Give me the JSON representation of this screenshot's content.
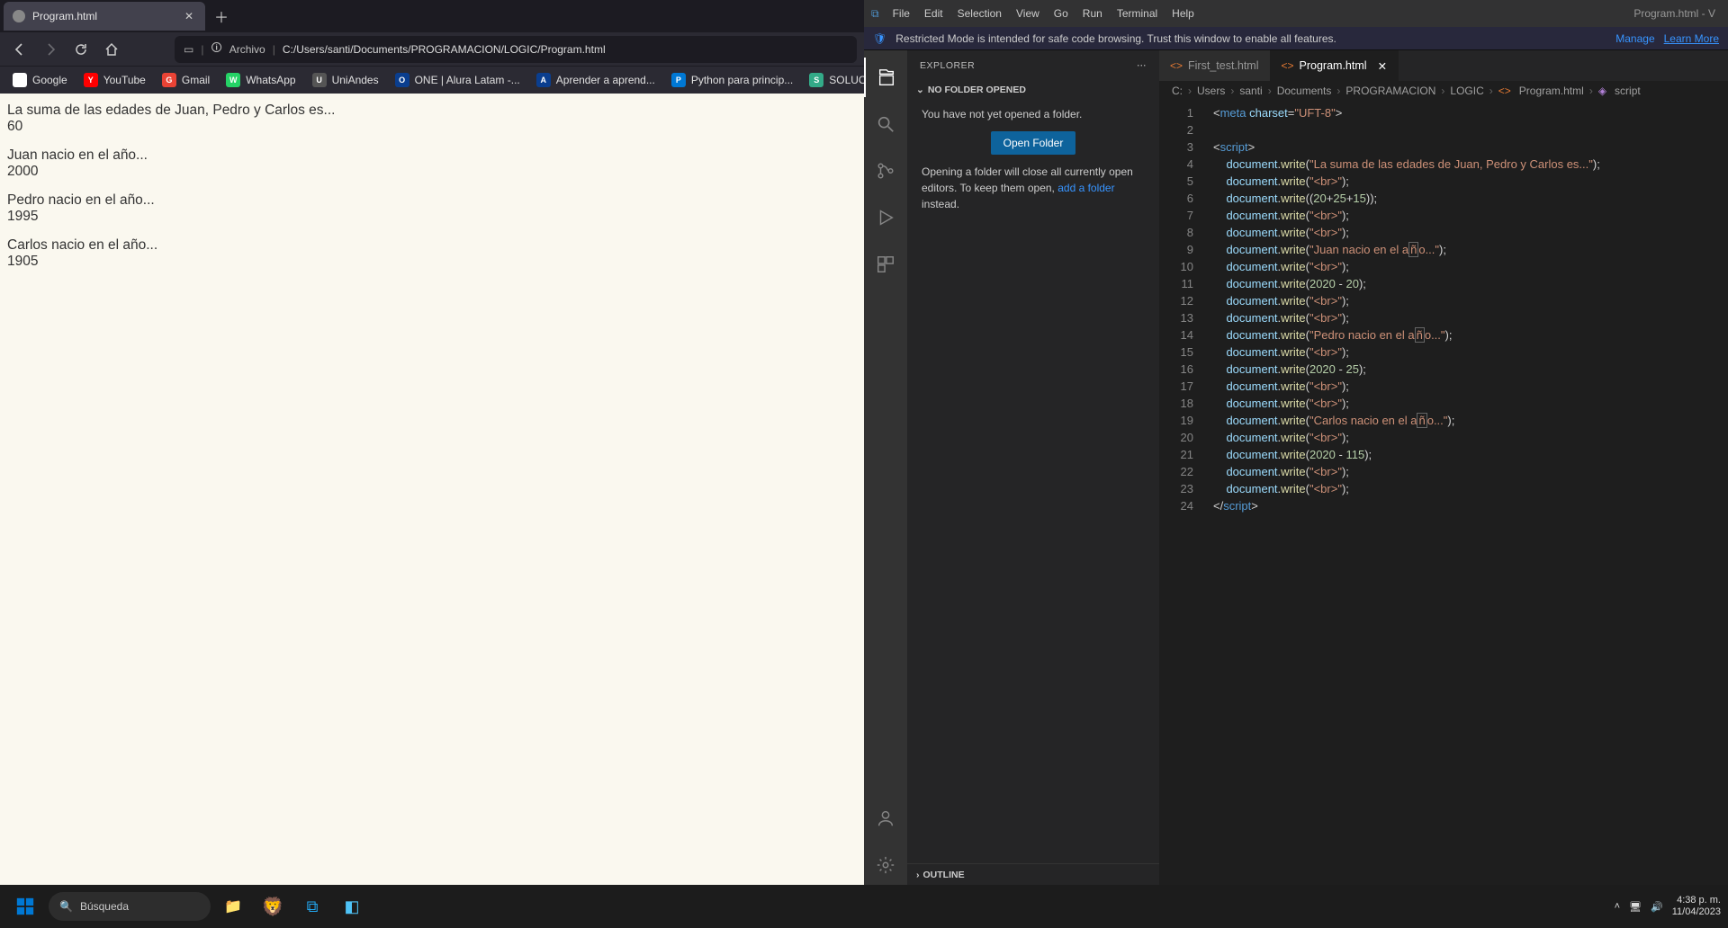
{
  "browser": {
    "tab_title": "Program.html",
    "address_label": "Archivo",
    "address_path": "C:/Users/santi/Documents/PROGRAMACION/LOGIC/Program.html",
    "bookmarks": [
      {
        "label": "Google",
        "color": "#fff"
      },
      {
        "label": "YouTube",
        "color": "#f00"
      },
      {
        "label": "Gmail",
        "color": "#ea4335"
      },
      {
        "label": "WhatsApp",
        "color": "#25d366"
      },
      {
        "label": "UniAndes",
        "color": "#555"
      },
      {
        "label": "ONE | Alura Latam -...",
        "color": "#0a3e8f"
      },
      {
        "label": "Aprender a aprend...",
        "color": "#0a3e8f"
      },
      {
        "label": "Python para princip...",
        "color": "#0078d4"
      },
      {
        "label": "SOLUCI...",
        "color": "#3a8"
      }
    ],
    "page": {
      "line1": "La suma de las edades de Juan, Pedro y Carlos es...",
      "line1_val": "60",
      "line2": "Juan nacio en el año...",
      "line2_val": "2000",
      "line3": "Pedro nacio en el año...",
      "line3_val": "1995",
      "line4": "Carlos nacio en el año...",
      "line4_val": "1905"
    }
  },
  "vscode": {
    "window_title": "Program.html - V",
    "menus": [
      "File",
      "Edit",
      "Selection",
      "View",
      "Go",
      "Run",
      "Terminal",
      "Help"
    ],
    "notification": "Restricted Mode is intended for safe code browsing. Trust this window to enable all features.",
    "notif_manage": "Manage",
    "notif_learn": "Learn More",
    "sidebar": {
      "title": "EXPLORER",
      "section": "NO FOLDER OPENED",
      "msg1": "You have not yet opened a folder.",
      "open_btn": "Open Folder",
      "msg2a": "Opening a folder will close all currently open editors. To keep them open, ",
      "msg2b": "add a folder",
      "msg2c": " instead.",
      "outline": "OUTLINE"
    },
    "tabs": [
      {
        "label": "First_test.html",
        "active": false
      },
      {
        "label": "Program.html",
        "active": true
      }
    ],
    "breadcrumbs": [
      "C:",
      "Users",
      "santi",
      "Documents",
      "PROGRAMACION",
      "LOGIC",
      "Program.html",
      "script"
    ],
    "code_lines": [
      {
        "n": 1,
        "html": "<span class='tk-pun'>&lt;</span><span class='tk-tag'>meta</span> <span class='tk-attr'>charset</span><span class='tk-pun'>=</span><span class='tk-str'>\"UFT-8\"</span><span class='tk-pun'>&gt;</span>"
      },
      {
        "n": 2,
        "html": ""
      },
      {
        "n": 3,
        "html": "<span class='tk-pun'>&lt;</span><span class='tk-tag'>script</span><span class='tk-pun'>&gt;</span>"
      },
      {
        "n": 4,
        "html": "    <span class='tk-obj'>document</span><span class='tk-pun'>.</span><span class='tk-fn'>write</span><span class='tk-pun'>(</span><span class='tk-str'>\"La suma de las edades de Juan, Pedro y Carlos es...\"</span><span class='tk-pun'>);</span>"
      },
      {
        "n": 5,
        "html": "    <span class='tk-obj'>document</span><span class='tk-pun'>.</span><span class='tk-fn'>write</span><span class='tk-pun'>(</span><span class='tk-str'>\"&lt;br&gt;\"</span><span class='tk-pun'>);</span>"
      },
      {
        "n": 6,
        "html": "    <span class='tk-obj'>document</span><span class='tk-pun'>.</span><span class='tk-fn'>write</span><span class='tk-pun'>((</span><span class='tk-num'>20</span><span class='tk-pun'>+</span><span class='tk-num'>25</span><span class='tk-pun'>+</span><span class='tk-num'>15</span><span class='tk-pun'>));</span>"
      },
      {
        "n": 7,
        "html": "    <span class='tk-obj'>document</span><span class='tk-pun'>.</span><span class='tk-fn'>write</span><span class='tk-pun'>(</span><span class='tk-str'>\"&lt;br&gt;\"</span><span class='tk-pun'>);</span>"
      },
      {
        "n": 8,
        "html": "    <span class='tk-obj'>document</span><span class='tk-pun'>.</span><span class='tk-fn'>write</span><span class='tk-pun'>(</span><span class='tk-str'>\"&lt;br&gt;\"</span><span class='tk-pun'>);</span>"
      },
      {
        "n": 9,
        "html": "    <span class='tk-obj'>document</span><span class='tk-pun'>.</span><span class='tk-fn'>write</span><span class='tk-pun'>(</span><span class='tk-str'>\"Juan nacio en el a<span class='hl-box'>ñ</span>o...\"</span><span class='tk-pun'>);</span>"
      },
      {
        "n": 10,
        "html": "    <span class='tk-obj'>document</span><span class='tk-pun'>.</span><span class='tk-fn'>write</span><span class='tk-pun'>(</span><span class='tk-str'>\"&lt;br&gt;\"</span><span class='tk-pun'>);</span>"
      },
      {
        "n": 11,
        "html": "    <span class='tk-obj'>document</span><span class='tk-pun'>.</span><span class='tk-fn'>write</span><span class='tk-pun'>(</span><span class='tk-num'>2020</span> <span class='tk-pun'>-</span> <span class='tk-num'>20</span><span class='tk-pun'>);</span>"
      },
      {
        "n": 12,
        "html": "    <span class='tk-obj'>document</span><span class='tk-pun'>.</span><span class='tk-fn'>write</span><span class='tk-pun'>(</span><span class='tk-str'>\"&lt;br&gt;\"</span><span class='tk-pun'>);</span>"
      },
      {
        "n": 13,
        "html": "    <span class='tk-obj'>document</span><span class='tk-pun'>.</span><span class='tk-fn'>write</span><span class='tk-pun'>(</span><span class='tk-str'>\"&lt;br&gt;\"</span><span class='tk-pun'>);</span>"
      },
      {
        "n": 14,
        "html": "    <span class='tk-obj'>document</span><span class='tk-pun'>.</span><span class='tk-fn'>write</span><span class='tk-pun'>(</span><span class='tk-str'>\"Pedro nacio en el a<span class='hl-box'>ñ</span>o...\"</span><span class='tk-pun'>);</span>"
      },
      {
        "n": 15,
        "html": "    <span class='tk-obj'>document</span><span class='tk-pun'>.</span><span class='tk-fn'>write</span><span class='tk-pun'>(</span><span class='tk-str'>\"&lt;br&gt;\"</span><span class='tk-pun'>);</span>"
      },
      {
        "n": 16,
        "html": "    <span class='tk-obj'>document</span><span class='tk-pun'>.</span><span class='tk-fn'>write</span><span class='tk-pun'>(</span><span class='tk-num'>2020</span> <span class='tk-pun'>-</span> <span class='tk-num'>25</span><span class='tk-pun'>);</span>"
      },
      {
        "n": 17,
        "html": "    <span class='tk-obj'>document</span><span class='tk-pun'>.</span><span class='tk-fn'>write</span><span class='tk-pun'>(</span><span class='tk-str'>\"&lt;br&gt;\"</span><span class='tk-pun'>);</span>"
      },
      {
        "n": 18,
        "html": "    <span class='tk-obj'>document</span><span class='tk-pun'>.</span><span class='tk-fn'>write</span><span class='tk-pun'>(</span><span class='tk-str'>\"&lt;br&gt;\"</span><span class='tk-pun'>);</span>"
      },
      {
        "n": 19,
        "html": "    <span class='tk-obj'>document</span><span class='tk-pun'>.</span><span class='tk-fn'>write</span><span class='tk-pun'>(</span><span class='tk-str'>\"Carlos nacio en el a<span class='hl-box'>ñ</span>o...\"</span><span class='tk-pun'>);</span>"
      },
      {
        "n": 20,
        "html": "    <span class='tk-obj'>document</span><span class='tk-pun'>.</span><span class='tk-fn'>write</span><span class='tk-pun'>(</span><span class='tk-str'>\"&lt;br&gt;\"</span><span class='tk-pun'>);</span>"
      },
      {
        "n": 21,
        "html": "    <span class='tk-obj'>document</span><span class='tk-pun'>.</span><span class='tk-fn'>write</span><span class='tk-pun'>(</span><span class='tk-num'>2020</span> <span class='tk-pun'>-</span> <span class='tk-num'>115</span><span class='tk-pun'>);</span>"
      },
      {
        "n": 22,
        "html": "    <span class='tk-obj'>document</span><span class='tk-pun'>.</span><span class='tk-fn'>write</span><span class='tk-pun'>(</span><span class='tk-str'>\"&lt;br&gt;\"</span><span class='tk-pun'>);</span>"
      },
      {
        "n": 23,
        "html": "    <span class='tk-obj'>document</span><span class='tk-pun'>.</span><span class='tk-fn'>write</span><span class='tk-pun'>(</span><span class='tk-str'>\"&lt;br&gt;\"</span><span class='tk-pun'>);</span>"
      },
      {
        "n": 24,
        "html": "<span class='tk-pun'>&lt;/</span><span class='tk-tag'>script</span><span class='tk-pun'>&gt;</span>"
      }
    ]
  },
  "taskbar": {
    "search_placeholder": "Búsqueda",
    "time": "4:38 p. m.",
    "date": "11/04/2023"
  }
}
